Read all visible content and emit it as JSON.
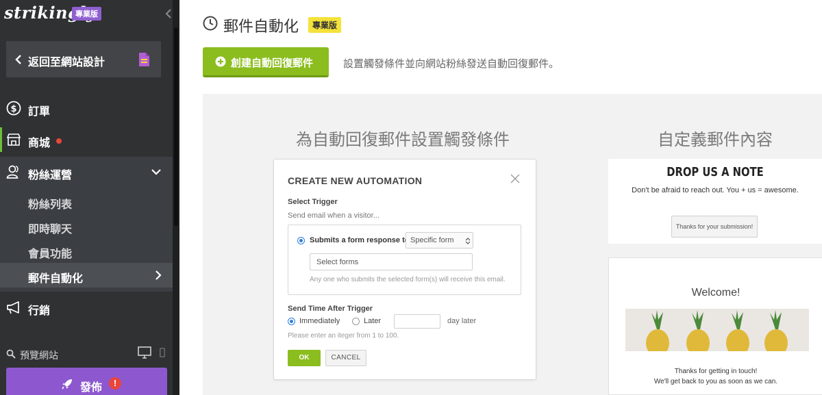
{
  "sidebar": {
    "logo": "strikingly",
    "logo_badge": "專業版",
    "back_label": "返回至網站設計",
    "items": [
      {
        "label": "訂單"
      },
      {
        "label": "商城"
      },
      {
        "label": "粉絲運營"
      },
      {
        "label": "行銷"
      }
    ],
    "fans_sub": [
      {
        "label": "粉絲列表"
      },
      {
        "label": "即時聊天"
      },
      {
        "label": "會員功能"
      },
      {
        "label": "郵件自動化"
      }
    ],
    "preview_label": "預覽網站",
    "publish_label": "發佈",
    "publish_warning": "!"
  },
  "main": {
    "title": "郵件自動化",
    "title_badge": "專業版",
    "create_label": "創建自動回復郵件",
    "create_desc": "設置觸發條件並向網站粉絲發送自動回復郵件。",
    "heading_left": "為自動回復郵件設置觸發條件",
    "heading_right": "自定義郵件內容"
  },
  "dialog": {
    "title": "CREATE NEW AUTOMATION",
    "select_trigger": "Select Trigger",
    "send_when": "Send email when a visitor...",
    "submits_label": "Submits a form response to",
    "select_value": "Specific form",
    "forms_placeholder": "Select forms",
    "forms_hint": "Any one who submits the selected form(s) will receive this email.",
    "send_time_label": "Send Time After Trigger",
    "immediately": "Immediately",
    "later": "Later",
    "day_later": "day later",
    "int_hint": "Please enter an itеger  from 1 to 100.",
    "ok": "OK",
    "cancel": "CANCEL"
  },
  "preview": {
    "card1_title": "DROP US A NOTE",
    "card1_sub": "Don't be afraid to reach out. You + us = awesome.",
    "card1_button": "Thanks for your submission!",
    "card2_title": "Welcome!",
    "card2_line1": "Thanks for getting in touch!",
    "card2_line2": "We'll get back to you as soon as we can."
  },
  "colors": {
    "sidebar_bg": "#2f3133",
    "accent_green": "#8bbd1f",
    "accent_purple": "#8d58cf",
    "pro_badge": "#f5e23a",
    "radio_blue": "#2b7de0"
  }
}
